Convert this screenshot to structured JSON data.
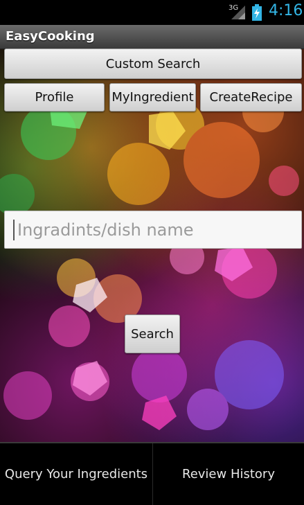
{
  "status_bar": {
    "network": "3G",
    "time": "4:16"
  },
  "app": {
    "title": "EasyCooking"
  },
  "buttons": {
    "custom_search": "Custom Search",
    "profile": "Profile",
    "my_ingredient": "MyIngredient",
    "create_recipe": "CreateRecipe",
    "search": "Search"
  },
  "search_input": {
    "value": "",
    "placeholder": "Ingradints/dish name"
  },
  "bottom_tabs": [
    {
      "label": "Query Your Ingredients"
    },
    {
      "label": "Review History"
    }
  ],
  "colors": {
    "status_accent": "#33b5e5"
  }
}
